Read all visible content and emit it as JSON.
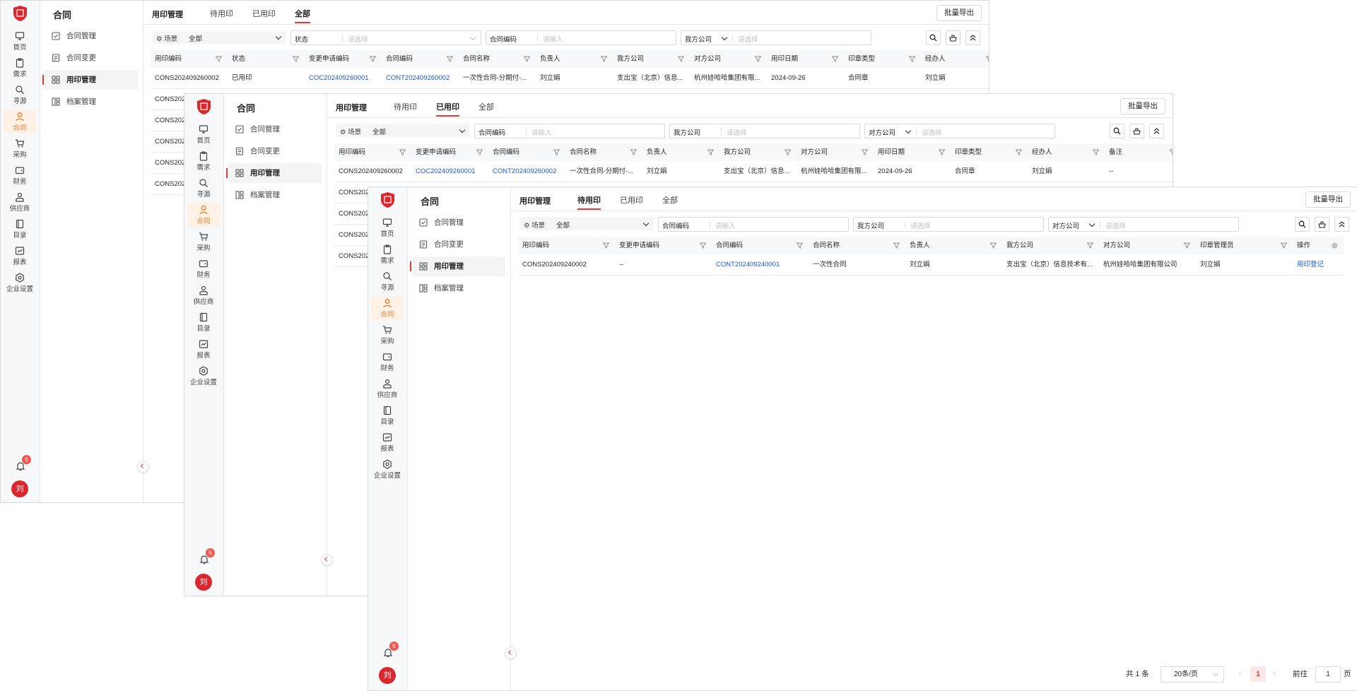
{
  "rail": {
    "items": [
      {
        "label": "首页",
        "icon": "monitor-icon"
      },
      {
        "label": "需求",
        "icon": "clipboard-icon"
      },
      {
        "label": "寻源",
        "icon": "search-doc-icon"
      },
      {
        "label": "合同",
        "icon": "person-icon"
      },
      {
        "label": "采购",
        "icon": "cart-icon"
      },
      {
        "label": "财务",
        "icon": "wallet-icon"
      },
      {
        "label": "供应商",
        "icon": "supplier-icon"
      },
      {
        "label": "目录",
        "icon": "book-icon"
      },
      {
        "label": "报表",
        "icon": "report-icon"
      },
      {
        "label": "企业设置",
        "icon": "settings-icon"
      }
    ],
    "notification_count": "6",
    "avatar_text": "刘",
    "active_color": "#f07c2a"
  },
  "submenu": {
    "title": "合同",
    "items": [
      "合同管理",
      "合同变更",
      "用印管理",
      "档案管理"
    ]
  },
  "tabs": {
    "title": "用印管理",
    "items": [
      "待用印",
      "已用印",
      "全部"
    ],
    "export_label": "批量导出"
  },
  "filters": {
    "scene_label": "场景",
    "scene_value": "全部",
    "status_label": "状态",
    "contract_code_label": "合同编码",
    "our_company_label": "我方公司",
    "counterparty_label": "对方公司",
    "select_placeholder": "请选择",
    "input_placeholder": "请输入"
  },
  "window1": {
    "columns": [
      "用印编码",
      "状态",
      "变更申请编码",
      "合同编码",
      "合同名称",
      "负责人",
      "我方公司",
      "对方公司",
      "用印日期",
      "印章类型",
      "经办人"
    ],
    "rows": [
      [
        "CONS202409260002",
        "已用印",
        "COC202409260001",
        "CONT202409260002",
        "一次性合同-分期付-...",
        "刘立娟",
        "支出宝（北京）信息...",
        "杭州娃哈哈集团有限...",
        "2024-09-26",
        "合同章",
        "刘立娟"
      ]
    ],
    "partial_rows": [
      "CONS202",
      "CONS202",
      "CONS202",
      "CONS202",
      "CONS202"
    ]
  },
  "window2": {
    "columns": [
      "用印编码",
      "变更申请编码",
      "合同编码",
      "合同名称",
      "负责人",
      "我方公司",
      "对方公司",
      "用印日期",
      "印章类型",
      "经办人",
      "备注"
    ],
    "rows": [
      [
        "CONS202409260002",
        "COC202409260001",
        "CONT202409260002",
        "一次性合同-分期付-...",
        "刘立娟",
        "支出宝（北京）信息...",
        "杭州娃哈哈集团有限...",
        "2024-09-26",
        "合同章",
        "刘立娟",
        "--"
      ]
    ],
    "partial_rows": [
      "CONS202",
      "CONS202",
      "CONS202",
      "CONS202"
    ]
  },
  "window3": {
    "columns": [
      "用印编码",
      "变更申请编码",
      "合同编码",
      "合同名称",
      "负责人",
      "我方公司",
      "对方公司",
      "印章管理员",
      "操作"
    ],
    "rows": [
      [
        "CONS202409240002",
        "--",
        "CONT202409240001",
        "一次性合同",
        "刘立娟",
        "支出宝（北京）信息技术有...",
        "杭州娃哈哈集团有限公司",
        "刘立娟",
        "用印登记"
      ]
    ],
    "pagination": {
      "total": "共 1 条",
      "page_size": "20条/页",
      "current_page": "1",
      "goto_label": "前往",
      "goto_value": "1",
      "page_suffix": "页"
    }
  }
}
